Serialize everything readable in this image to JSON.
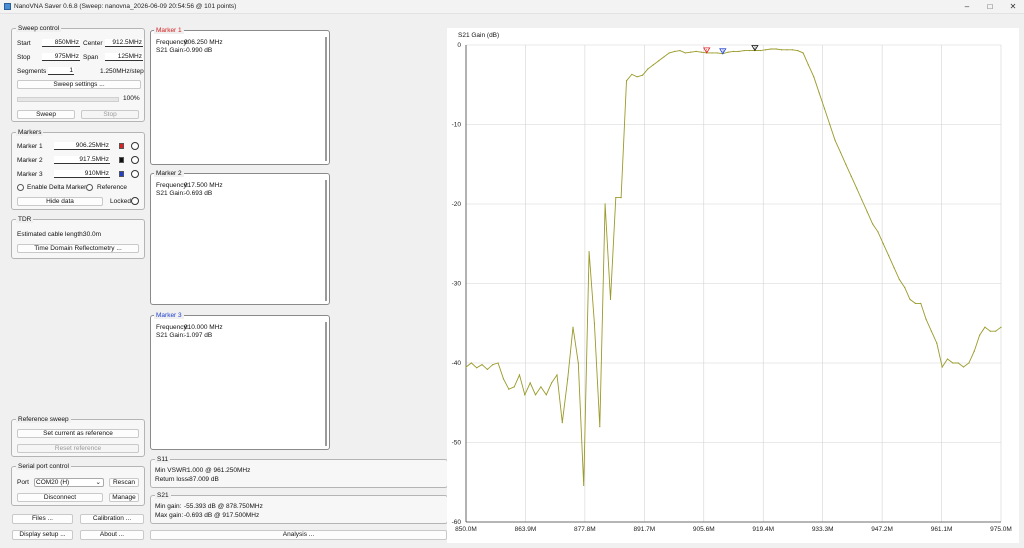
{
  "window": {
    "title": "NanoVNA Saver 0.6.8 (Sweep: nanovna_2026-06-09 20:54:56 @ 101 points)"
  },
  "sweep_control": {
    "title": "Sweep control",
    "start_label": "Start",
    "start_value": "850MHz",
    "center_label": "Center",
    "center_value": "912.5MHz",
    "stop_label": "Stop",
    "stop_value": "975MHz",
    "span_label": "Span",
    "span_value": "125MHz",
    "segments_label": "Segments",
    "segments_value": "1",
    "step_text": "1.250MHz/step",
    "settings_button": "Sweep settings ...",
    "progress": "100%",
    "sweep_button": "Sweep",
    "stop_button": "Stop"
  },
  "markers": {
    "title": "Markers",
    "items": [
      {
        "label": "Marker 1",
        "value": "906.25MHz",
        "color": "#e02020"
      },
      {
        "label": "Marker 2",
        "value": "917.5MHz",
        "color": "#111111"
      },
      {
        "label": "Marker 3",
        "value": "910MHz",
        "color": "#1f3fd0"
      }
    ],
    "delta_label": "Enable Delta Marker",
    "reference_label": "Reference",
    "hide_button": "Hide data",
    "locked_label": "Locked"
  },
  "tdr": {
    "title": "TDR",
    "cable_text": "Estimated cable length:",
    "cable_value": "30.0m",
    "tdr_button": "Time Domain Reflectometry ..."
  },
  "reference_sweep": {
    "title": "Reference sweep",
    "set_button": "Set current as reference",
    "reset_button": "Reset reference"
  },
  "serial": {
    "title": "Serial port control",
    "port_label": "Port",
    "port_value": "COM20 (H)",
    "rescan_button": "Rescan",
    "disconnect_button": "Disconnect",
    "manage_button": "Manage"
  },
  "bottom_buttons": {
    "files": "Files ...",
    "calibration": "Calibration ...",
    "display": "Display setup ...",
    "about": "About ...",
    "analysis": "Analysis ..."
  },
  "marker_panels": [
    {
      "title": "Marker 1",
      "title_color": "#d42020",
      "freq_label": "Frequency:",
      "freq": "906.250 MHz",
      "gain_label": "S21 Gain:",
      "gain": "-0.990 dB"
    },
    {
      "title": "Marker 2",
      "title_color": "#111111",
      "freq_label": "Frequency:",
      "freq": "917.500 MHz",
      "gain_label": "S21 Gain:",
      "gain": "-0.693 dB"
    },
    {
      "title": "Marker 3",
      "title_color": "#1f3fd0",
      "freq_label": "Frequency:",
      "freq": "910.000 MHz",
      "gain_label": "S21 Gain:",
      "gain": "-1.097 dB"
    }
  ],
  "s11": {
    "title": "S11",
    "vswr_label": "Min VSWR:",
    "vswr_value": "1.000 @ 961.250MHz",
    "rl_label": "Return loss:",
    "rl_value": "-87.009 dB"
  },
  "s21": {
    "title": "S21",
    "min_label": "Min gain:",
    "min_value": "-55.393 dB @ 878.750MHz",
    "max_label": "Max gain:",
    "max_value": "-0.693 dB @ 917.500MHz"
  },
  "chart_data": {
    "type": "line",
    "title": "S21 Gain (dB)",
    "xlabel": "",
    "ylabel": "",
    "xlim": [
      850.0,
      975.0
    ],
    "ylim": [
      -60,
      0
    ],
    "x_ticks": [
      "850.0M",
      "863.9M",
      "877.8M",
      "891.7M",
      "905.6M",
      "919.4M",
      "933.3M",
      "947.2M",
      "961.1M",
      "975.0M"
    ],
    "y_ticks": [
      "0",
      "-10",
      "-20",
      "-30",
      "-40",
      "-50",
      "-60"
    ],
    "grid": true,
    "line_color": "#9a9a2a",
    "x": [
      850.0,
      851.25,
      852.5,
      853.75,
      855.0,
      856.25,
      857.5,
      858.75,
      860.0,
      861.25,
      862.5,
      863.75,
      865.0,
      866.25,
      867.5,
      868.75,
      870.0,
      871.25,
      872.5,
      873.75,
      875.0,
      876.25,
      877.5,
      878.75,
      880.0,
      881.25,
      882.5,
      883.75,
      885.0,
      886.25,
      887.5,
      888.75,
      890.0,
      891.25,
      892.5,
      893.75,
      895.0,
      896.25,
      897.5,
      898.75,
      900.0,
      901.25,
      902.5,
      903.75,
      905.0,
      906.25,
      907.5,
      908.75,
      910.0,
      911.25,
      912.5,
      913.75,
      915.0,
      916.25,
      917.5,
      918.75,
      920.0,
      921.25,
      922.5,
      923.75,
      925.0,
      926.25,
      927.5,
      928.75,
      930.0,
      931.25,
      932.5,
      933.75,
      935.0,
      936.25,
      937.5,
      938.75,
      940.0,
      941.25,
      942.5,
      943.75,
      945.0,
      946.25,
      947.5,
      948.75,
      950.0,
      951.25,
      952.5,
      953.75,
      955.0,
      956.25,
      957.5,
      958.75,
      960.0,
      961.25,
      962.5,
      963.75,
      965.0,
      966.25,
      967.5,
      968.75,
      970.0,
      971.25,
      972.5,
      973.75,
      975.0
    ],
    "y": [
      -40.5,
      -40.0,
      -40.6,
      -40.2,
      -40.8,
      -40.2,
      -40.0,
      -42.0,
      -43.3,
      -43.0,
      -41.5,
      -44.0,
      -42.5,
      -44.0,
      -43.0,
      -44.0,
      -42.5,
      -41.5,
      -47.5,
      -42.0,
      -35.5,
      -40.0,
      -55.4,
      -26.0,
      -35.0,
      -48.0,
      -20.0,
      -32.0,
      -19.2,
      -19.2,
      -4.5,
      -3.7,
      -4.0,
      -3.8,
      -3.0,
      -2.5,
      -2.0,
      -1.5,
      -1.0,
      -0.8,
      -0.7,
      -1.0,
      -0.9,
      -0.8,
      -0.9,
      -0.99,
      -1.0,
      -1.0,
      -1.097,
      -0.9,
      -0.8,
      -0.8,
      -0.7,
      -0.7,
      -0.693,
      -0.7,
      -0.6,
      -0.5,
      -0.5,
      -0.6,
      -0.6,
      -0.6,
      -0.7,
      -1.0,
      -2.5,
      -4.0,
      -6.0,
      -8.0,
      -10.0,
      -12.0,
      -13.5,
      -15.0,
      -16.5,
      -18.0,
      -19.5,
      -21.0,
      -22.5,
      -23.5,
      -25.0,
      -26.5,
      -28.0,
      -29.5,
      -30.5,
      -32.0,
      -32.5,
      -32.5,
      -34.5,
      -36.0,
      -37.5,
      -40.5,
      -39.5,
      -40.0,
      -40.0,
      -40.5,
      -40.0,
      -38.5,
      -36.5,
      -35.5,
      -36.0,
      -36.0,
      -35.5
    ],
    "markers": [
      {
        "label": "1",
        "x": 906.25,
        "y": -0.99,
        "color": "#e02020"
      },
      {
        "label": "2",
        "x": 917.5,
        "y": -0.693,
        "color": "#111111"
      },
      {
        "label": "3",
        "x": 910.0,
        "y": -1.097,
        "color": "#1f3fd0"
      }
    ]
  }
}
